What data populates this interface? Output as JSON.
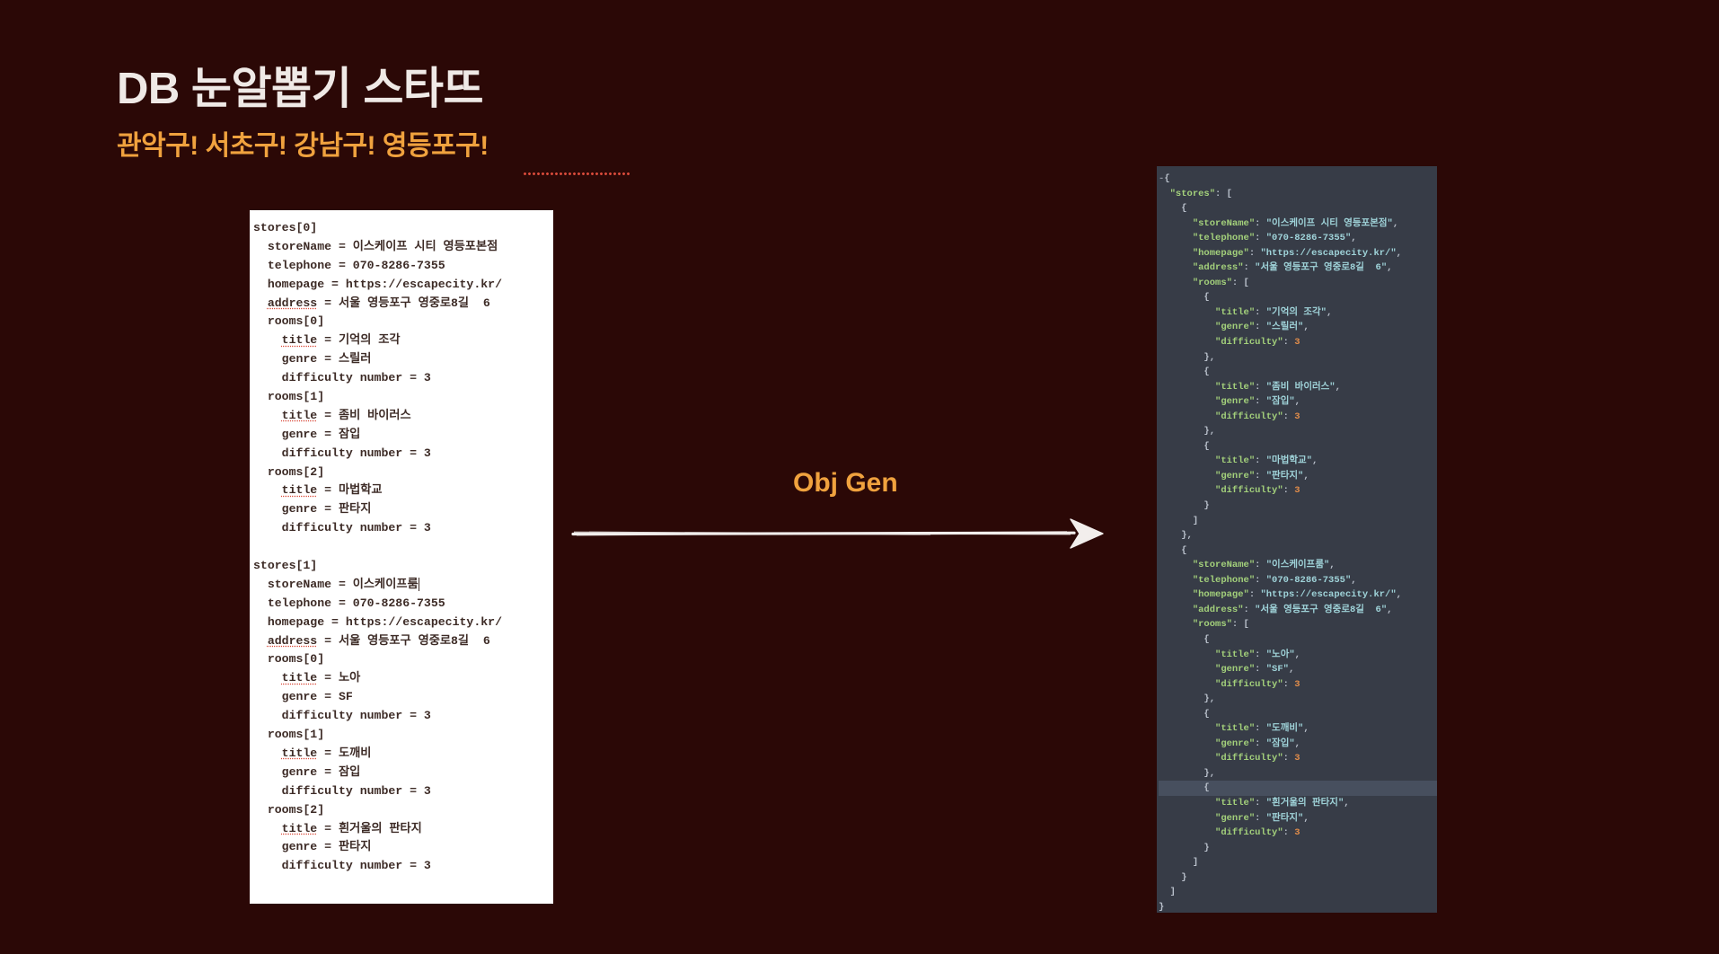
{
  "heading": {
    "title": "DB 눈알뽑기 스타뜨",
    "subtitle": "관악구! 서초구! 강남구! 영등포구!",
    "title_color": "#efe9e6",
    "subtitle_color": "#f0a23e",
    "underline_color": "#d94a3a"
  },
  "background_color": "#2b0806",
  "center": {
    "label": "Obj Gen",
    "label_color": "#f0a23e",
    "arrow_color": "#f2eeec",
    "arrow_direction": "right"
  },
  "left_panel": {
    "background_color": "#ffffff",
    "text_color": "#3d2b26",
    "lines": [
      "stores[0]",
      "  storeName = 이스케이프 시티 영등포본점",
      "  telephone = 070-8286-7355",
      "  homepage = https://escapecity.kr/",
      "  address = 서울 영등포구 영중로8길  6",
      "  rooms[0]",
      "    title = 기억의 조각",
      "    genre = 스릴러",
      "    difficulty number = 3",
      "  rooms[1]",
      "    title = 좀비 바이러스",
      "    genre = 잠입",
      "    difficulty number = 3",
      "  rooms[2]",
      "    title = 마법학교",
      "    genre = 판타지",
      "    difficulty number = 3",
      "",
      "stores[1]",
      "  storeName = 이스케이프룸",
      "  telephone = 070-8286-7355",
      "  homepage = https://escapecity.kr/",
      "  address = 서울 영등포구 영중로8길  6",
      "  rooms[0]",
      "    title = 노아",
      "    genre = SF",
      "    difficulty number = 3",
      "  rooms[1]",
      "    title = 도깨비",
      "    genre = 잠입",
      "    difficulty number = 3",
      "  rooms[2]",
      "    title = 흰거울의 판타지",
      "    genre = 판타지",
      "    difficulty number = 3"
    ],
    "spellcheck_underlined_words": [
      "address",
      "title"
    ],
    "caret_after_line_index": 19
  },
  "right_panel": {
    "background_color": "#373c47",
    "key_color": "#a3d07b",
    "string_color": "#9fd3d9",
    "number_color": "#e08c4a",
    "punctuation_color": "#b9c0cb",
    "highlight_line_color": "#474f5e",
    "fold_marker": "-",
    "highlighted_line_index": 41,
    "lines": [
      {
        "indent": 0,
        "fold": true,
        "parts": [
          [
            "p",
            "{"
          ]
        ]
      },
      {
        "indent": 1,
        "parts": [
          [
            "k",
            "\"stores\""
          ],
          [
            "p",
            ": ["
          ]
        ]
      },
      {
        "indent": 2,
        "parts": [
          [
            "p",
            "{"
          ]
        ]
      },
      {
        "indent": 3,
        "parts": [
          [
            "k",
            "\"storeName\""
          ],
          [
            "p",
            ": "
          ],
          [
            "s",
            "\"이스케이프 시티 영등포본점\""
          ],
          [
            "p",
            ","
          ]
        ]
      },
      {
        "indent": 3,
        "parts": [
          [
            "k",
            "\"telephone\""
          ],
          [
            "p",
            ": "
          ],
          [
            "s",
            "\"070-8286-7355\""
          ],
          [
            "p",
            ","
          ]
        ]
      },
      {
        "indent": 3,
        "parts": [
          [
            "k",
            "\"homepage\""
          ],
          [
            "p",
            ": "
          ],
          [
            "s",
            "\"https://escapecity.kr/\""
          ],
          [
            "p",
            ","
          ]
        ]
      },
      {
        "indent": 3,
        "parts": [
          [
            "k",
            "\"address\""
          ],
          [
            "p",
            ": "
          ],
          [
            "s",
            "\"서울 영등포구 영중로8길  6\""
          ],
          [
            "p",
            ","
          ]
        ]
      },
      {
        "indent": 3,
        "parts": [
          [
            "k",
            "\"rooms\""
          ],
          [
            "p",
            ": ["
          ]
        ]
      },
      {
        "indent": 4,
        "parts": [
          [
            "p",
            "{"
          ]
        ]
      },
      {
        "indent": 5,
        "parts": [
          [
            "k",
            "\"title\""
          ],
          [
            "p",
            ": "
          ],
          [
            "s",
            "\"기억의 조각\""
          ],
          [
            "p",
            ","
          ]
        ]
      },
      {
        "indent": 5,
        "parts": [
          [
            "k",
            "\"genre\""
          ],
          [
            "p",
            ": "
          ],
          [
            "s",
            "\"스릴러\""
          ],
          [
            "p",
            ","
          ]
        ]
      },
      {
        "indent": 5,
        "parts": [
          [
            "k",
            "\"difficulty\""
          ],
          [
            "p",
            ": "
          ],
          [
            "n",
            "3"
          ]
        ]
      },
      {
        "indent": 4,
        "parts": [
          [
            "p",
            "},"
          ]
        ]
      },
      {
        "indent": 4,
        "parts": [
          [
            "p",
            "{"
          ]
        ]
      },
      {
        "indent": 5,
        "parts": [
          [
            "k",
            "\"title\""
          ],
          [
            "p",
            ": "
          ],
          [
            "s",
            "\"좀비 바이러스\""
          ],
          [
            "p",
            ","
          ]
        ]
      },
      {
        "indent": 5,
        "parts": [
          [
            "k",
            "\"genre\""
          ],
          [
            "p",
            ": "
          ],
          [
            "s",
            "\"잠입\""
          ],
          [
            "p",
            ","
          ]
        ]
      },
      {
        "indent": 5,
        "parts": [
          [
            "k",
            "\"difficulty\""
          ],
          [
            "p",
            ": "
          ],
          [
            "n",
            "3"
          ]
        ]
      },
      {
        "indent": 4,
        "parts": [
          [
            "p",
            "},"
          ]
        ]
      },
      {
        "indent": 4,
        "parts": [
          [
            "p",
            "{"
          ]
        ]
      },
      {
        "indent": 5,
        "parts": [
          [
            "k",
            "\"title\""
          ],
          [
            "p",
            ": "
          ],
          [
            "s",
            "\"마법학교\""
          ],
          [
            "p",
            ","
          ]
        ]
      },
      {
        "indent": 5,
        "parts": [
          [
            "k",
            "\"genre\""
          ],
          [
            "p",
            ": "
          ],
          [
            "s",
            "\"판타지\""
          ],
          [
            "p",
            ","
          ]
        ]
      },
      {
        "indent": 5,
        "parts": [
          [
            "k",
            "\"difficulty\""
          ],
          [
            "p",
            ": "
          ],
          [
            "n",
            "3"
          ]
        ]
      },
      {
        "indent": 4,
        "parts": [
          [
            "p",
            "}"
          ]
        ]
      },
      {
        "indent": 3,
        "parts": [
          [
            "p",
            "]"
          ]
        ]
      },
      {
        "indent": 2,
        "parts": [
          [
            "p",
            "},"
          ]
        ]
      },
      {
        "indent": 2,
        "parts": [
          [
            "p",
            "{"
          ]
        ]
      },
      {
        "indent": 3,
        "parts": [
          [
            "k",
            "\"storeName\""
          ],
          [
            "p",
            ": "
          ],
          [
            "s",
            "\"이스케이프룸\""
          ],
          [
            "p",
            ","
          ]
        ]
      },
      {
        "indent": 3,
        "parts": [
          [
            "k",
            "\"telephone\""
          ],
          [
            "p",
            ": "
          ],
          [
            "s",
            "\"070-8286-7355\""
          ],
          [
            "p",
            ","
          ]
        ]
      },
      {
        "indent": 3,
        "parts": [
          [
            "k",
            "\"homepage\""
          ],
          [
            "p",
            ": "
          ],
          [
            "s",
            "\"https://escapecity.kr/\""
          ],
          [
            "p",
            ","
          ]
        ]
      },
      {
        "indent": 3,
        "parts": [
          [
            "k",
            "\"address\""
          ],
          [
            "p",
            ": "
          ],
          [
            "s",
            "\"서울 영등포구 영중로8길  6\""
          ],
          [
            "p",
            ","
          ]
        ]
      },
      {
        "indent": 3,
        "parts": [
          [
            "k",
            "\"rooms\""
          ],
          [
            "p",
            ": ["
          ]
        ]
      },
      {
        "indent": 4,
        "parts": [
          [
            "p",
            "{"
          ]
        ]
      },
      {
        "indent": 5,
        "parts": [
          [
            "k",
            "\"title\""
          ],
          [
            "p",
            ": "
          ],
          [
            "s",
            "\"노아\""
          ],
          [
            "p",
            ","
          ]
        ]
      },
      {
        "indent": 5,
        "parts": [
          [
            "k",
            "\"genre\""
          ],
          [
            "p",
            ": "
          ],
          [
            "s",
            "\"SF\""
          ],
          [
            "p",
            ","
          ]
        ]
      },
      {
        "indent": 5,
        "parts": [
          [
            "k",
            "\"difficulty\""
          ],
          [
            "p",
            ": "
          ],
          [
            "n",
            "3"
          ]
        ]
      },
      {
        "indent": 4,
        "parts": [
          [
            "p",
            "},"
          ]
        ]
      },
      {
        "indent": 4,
        "parts": [
          [
            "p",
            "{"
          ]
        ]
      },
      {
        "indent": 5,
        "parts": [
          [
            "k",
            "\"title\""
          ],
          [
            "p",
            ": "
          ],
          [
            "s",
            "\"도깨비\""
          ],
          [
            "p",
            ","
          ]
        ]
      },
      {
        "indent": 5,
        "parts": [
          [
            "k",
            "\"genre\""
          ],
          [
            "p",
            ": "
          ],
          [
            "s",
            "\"잠입\""
          ],
          [
            "p",
            ","
          ]
        ]
      },
      {
        "indent": 5,
        "parts": [
          [
            "k",
            "\"difficulty\""
          ],
          [
            "p",
            ": "
          ],
          [
            "n",
            "3"
          ]
        ]
      },
      {
        "indent": 4,
        "parts": [
          [
            "p",
            "},"
          ]
        ]
      },
      {
        "indent": 4,
        "parts": [
          [
            "p",
            "{"
          ]
        ]
      },
      {
        "indent": 5,
        "parts": [
          [
            "k",
            "\"title\""
          ],
          [
            "p",
            ": "
          ],
          [
            "s",
            "\"흰거울의 판타지\""
          ],
          [
            "p",
            ","
          ]
        ]
      },
      {
        "indent": 5,
        "parts": [
          [
            "k",
            "\"genre\""
          ],
          [
            "p",
            ": "
          ],
          [
            "s",
            "\"판타지\""
          ],
          [
            "p",
            ","
          ]
        ]
      },
      {
        "indent": 5,
        "parts": [
          [
            "k",
            "\"difficulty\""
          ],
          [
            "p",
            ": "
          ],
          [
            "n",
            "3"
          ]
        ]
      },
      {
        "indent": 4,
        "parts": [
          [
            "p",
            "}"
          ]
        ]
      },
      {
        "indent": 3,
        "parts": [
          [
            "p",
            "]"
          ]
        ]
      },
      {
        "indent": 2,
        "parts": [
          [
            "p",
            "}"
          ]
        ]
      },
      {
        "indent": 1,
        "parts": [
          [
            "p",
            "]"
          ]
        ]
      },
      {
        "indent": 0,
        "parts": [
          [
            "p",
            "}"
          ]
        ]
      }
    ]
  }
}
